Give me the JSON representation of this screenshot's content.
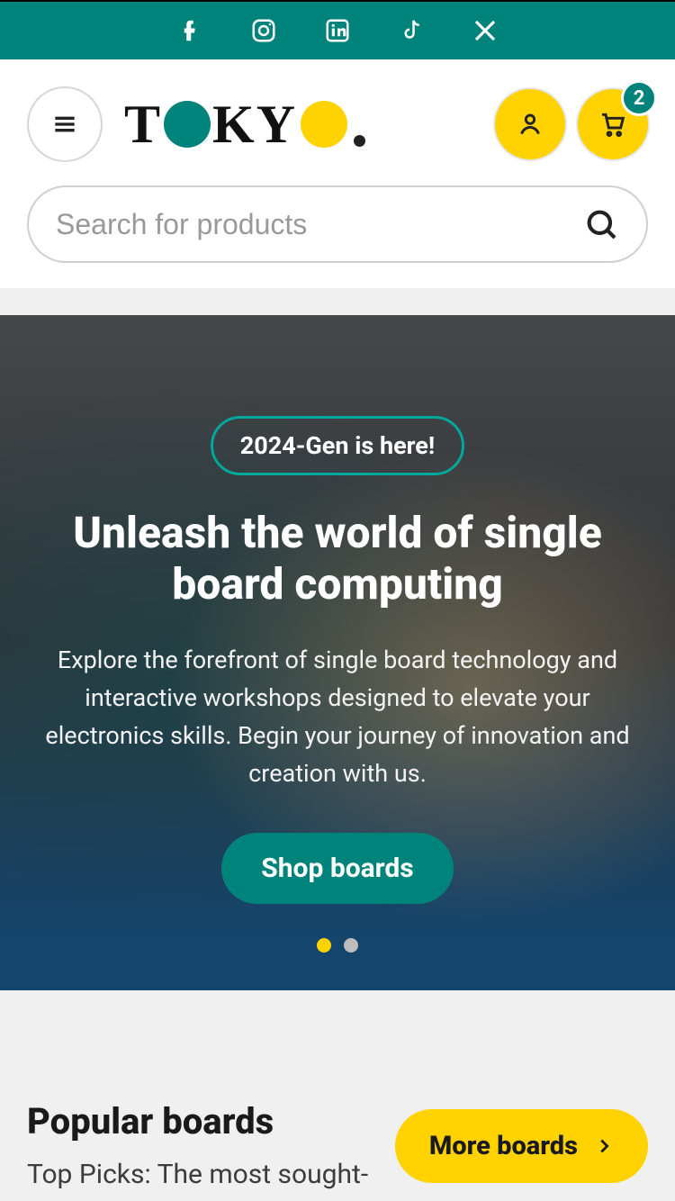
{
  "social": [
    "facebook",
    "instagram",
    "linkedin",
    "tiktok",
    "x"
  ],
  "logo": {
    "text_parts": [
      "T",
      "K",
      "Y"
    ]
  },
  "header": {
    "cart_badge": "2"
  },
  "search": {
    "placeholder": "Search for products"
  },
  "hero": {
    "pill": "2024-Gen is here!",
    "title": "Unleash the world of single board computing",
    "desc": "Explore the forefront of single board technology and interactive workshops designed to elevate your electronics skills. Begin your journey of innovation and creation with us.",
    "cta": "Shop boards",
    "active_dot": 0,
    "dot_count": 2
  },
  "popular": {
    "title": "Popular boards",
    "sub": "Top Picks: The most sought-",
    "more": "More boards"
  }
}
